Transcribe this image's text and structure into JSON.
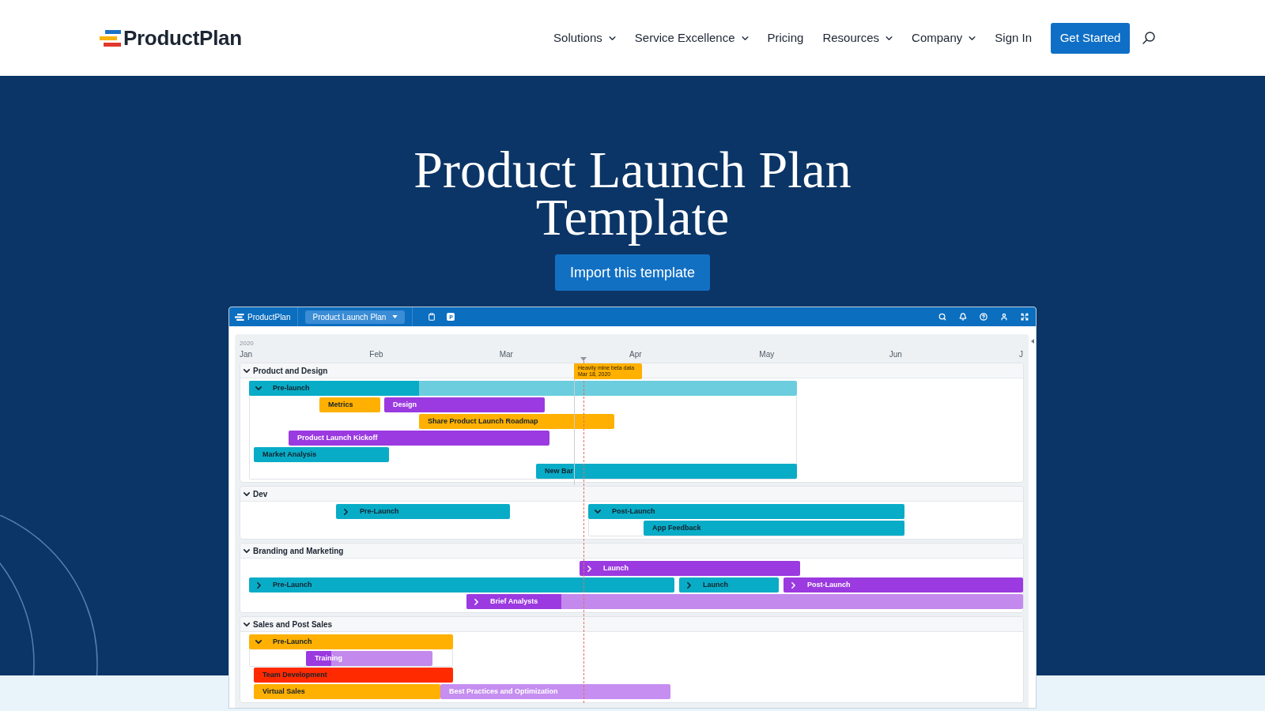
{
  "header": {
    "logo": "ProductPlan",
    "nav": [
      {
        "label": "Solutions",
        "kind": "menu"
      },
      {
        "label": "Service Excellence",
        "kind": "menu"
      },
      {
        "label": "Pricing",
        "kind": "link"
      },
      {
        "label": "Resources",
        "kind": "menu"
      },
      {
        "label": "Company",
        "kind": "menu"
      },
      {
        "label": "Sign In",
        "kind": "link"
      }
    ],
    "cta": "Get Started"
  },
  "hero": {
    "title": "Product Launch Plan Template",
    "button": "Import this template"
  },
  "roadmap": {
    "toolbar": {
      "app_name": "ProductPlan",
      "plan_selector": "Product Launch Plan",
      "tile_letter": "P"
    },
    "year": "2020",
    "months": [
      "Jan",
      "Feb",
      "Mar",
      "Apr",
      "May",
      "Jun",
      "J"
    ],
    "milestone": {
      "title": "Heavily mine beta data",
      "date": "Mar 18, 2020"
    },
    "groups": [
      {
        "name": "Product and Design",
        "expanded": true,
        "rows": [
          [
            {
              "label": "Pre-launch",
              "kind": "container",
              "expanded": true,
              "color": "#09acc7",
              "level": 0.31,
              "children": [
                [
                  {
                    "label": "Metrics",
                    "kind": "bar",
                    "color": "#ffb000"
                  },
                  {
                    "label": "Design",
                    "kind": "bar",
                    "color": "#9b3ae0"
                  }
                ],
                [
                  {
                    "label": "Share Product Launch Roadmap",
                    "kind": "bar",
                    "color": "#ffb000"
                  }
                ],
                [
                  {
                    "label": "Product Launch Kickoff",
                    "kind": "bar",
                    "color": "#9b3ae0"
                  }
                ],
                [
                  {
                    "label": "Market Analysis",
                    "kind": "bar",
                    "color": "#09acc7"
                  }
                ],
                [
                  {
                    "label": "New Bar",
                    "kind": "bar",
                    "color": "#09acc7"
                  }
                ]
              ]
            }
          ]
        ]
      },
      {
        "name": "Dev",
        "expanded": true,
        "rows": [
          [
            {
              "label": "Pre-Launch",
              "kind": "container",
              "expanded": false,
              "color": "#09acc7"
            },
            {
              "label": "Post-Launch",
              "kind": "container",
              "expanded": true,
              "color": "#09acc7",
              "children": [
                [
                  {
                    "label": "App Feedback",
                    "kind": "bar",
                    "color": "#09acc7"
                  }
                ]
              ]
            }
          ]
        ]
      },
      {
        "name": "Branding and Marketing",
        "expanded": true,
        "rows": [
          [
            {
              "label": "Launch",
              "kind": "container",
              "expanded": false,
              "color": "#9b3ae0"
            }
          ],
          [
            {
              "label": "Pre-Launch",
              "kind": "container",
              "expanded": false,
              "color": "#09acc7"
            },
            {
              "label": "Launch",
              "kind": "container",
              "expanded": false,
              "color": "#09acc7"
            },
            {
              "label": "Post-Launch",
              "kind": "container",
              "expanded": false,
              "color": "#9b3ae0"
            }
          ],
          [
            {
              "label": "Brief Analysts",
              "kind": "container",
              "expanded": false,
              "color": "#9b3ae0",
              "level": 0.17
            }
          ]
        ]
      },
      {
        "name": "Sales and Post Sales",
        "expanded": true,
        "rows": [
          [
            {
              "label": "Pre-Launch",
              "kind": "container",
              "expanded": true,
              "color": "#ffb000",
              "children": [
                [
                  {
                    "label": "Training",
                    "kind": "bar",
                    "color": "#9b3ae0",
                    "level": 0.2
                  }
                ]
              ]
            }
          ],
          [
            {
              "label": "Team Development",
              "kind": "bar",
              "color": "#ff2a00"
            }
          ],
          [
            {
              "label": "Virtual Sales",
              "kind": "bar",
              "color": "#ffb000"
            },
            {
              "label": "Best Practices and Optimization",
              "kind": "bar",
              "color": "#c58ef0"
            }
          ]
        ]
      }
    ]
  }
}
